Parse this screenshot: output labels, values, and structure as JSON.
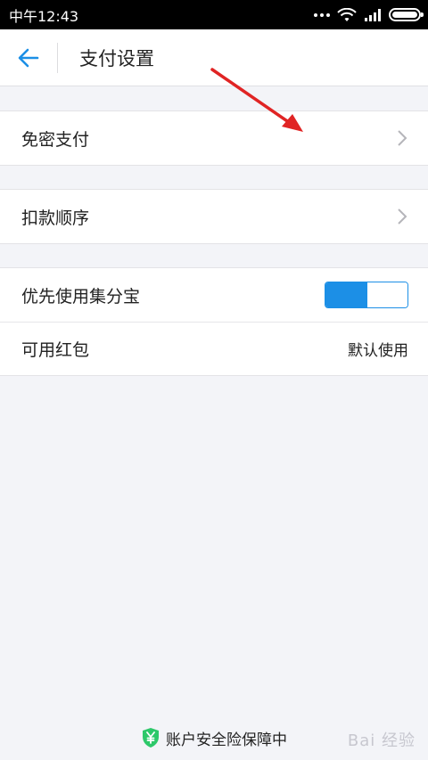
{
  "status_bar": {
    "time": "中午12:43"
  },
  "app_bar": {
    "title": "支付设置",
    "back_icon": "back-arrow-icon"
  },
  "groups": [
    {
      "items": [
        {
          "label": "免密支付",
          "accessory": "chevron"
        }
      ]
    },
    {
      "items": [
        {
          "label": "扣款顺序",
          "accessory": "chevron"
        }
      ]
    },
    {
      "items": [
        {
          "label": "优先使用集分宝",
          "accessory": "toggle",
          "toggle_on": true
        },
        {
          "label": "可用红包",
          "accessory": "value",
          "value": "默认使用"
        }
      ]
    }
  ],
  "footer": {
    "text": "账户安全险保障中",
    "icon": "shield-yuan-icon"
  },
  "watermark": "Bai 经验",
  "colors": {
    "accent": "#1c8fe6",
    "annotation_arrow": "#e02424",
    "shield": "#2dc86a"
  }
}
